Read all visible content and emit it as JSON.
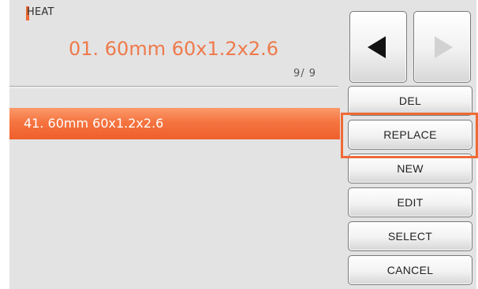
{
  "section": {
    "title": "HEAT"
  },
  "selected_program": {
    "name": "01. 60mm 60x1.2x2.6"
  },
  "pagination": {
    "counter": "9/ 9"
  },
  "list": {
    "items": [
      {
        "label": "41. 60mm 60x1.2x2.6",
        "selected": true
      }
    ]
  },
  "nav": {
    "prev_icon": "arrow-left-icon",
    "next_icon": "arrow-right-icon",
    "next_enabled": false
  },
  "buttons": {
    "del": "DEL",
    "replace": "REPLACE",
    "new": "NEW",
    "edit": "EDIT",
    "select": "SELECT",
    "cancel": "CANCEL"
  },
  "colors": {
    "accent": "#ee6a35",
    "heading": "#ee7a4c",
    "selection_bar": "#f57440",
    "background": "#e3e3e3",
    "disabled_arrow": "#d2d2d2"
  }
}
